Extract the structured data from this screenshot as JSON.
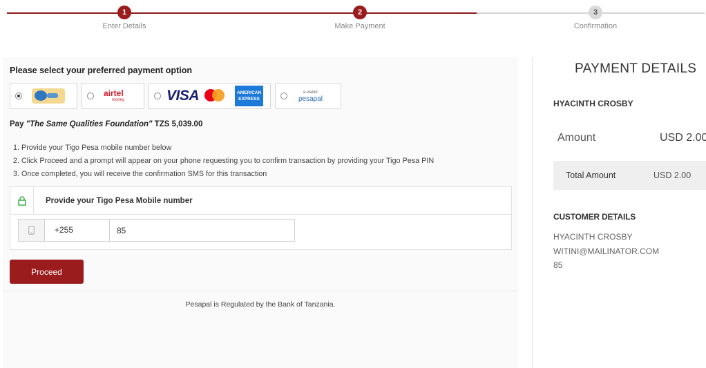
{
  "stepper": {
    "steps": [
      {
        "number": "1",
        "label": "Enter Details",
        "state": "completed"
      },
      {
        "number": "2",
        "label": "Make Payment",
        "state": "active"
      },
      {
        "number": "3",
        "label": "Confirmation",
        "state": "pending"
      }
    ],
    "accent_color": "#9b1c1c"
  },
  "payment_options": {
    "prompt": "Please select your preferred payment option",
    "options": [
      {
        "name": "tigo-pesa",
        "selected": true
      },
      {
        "name": "airtel-money",
        "selected": false,
        "logo_text": "airtel",
        "logo_subtext": "money"
      },
      {
        "name": "cards",
        "selected": false,
        "logo_text": "VISA",
        "amex_text": "AMERICAN EXPRESS"
      },
      {
        "name": "pesapal-ewallet",
        "selected": false,
        "logo_subtext": "e-wallet",
        "logo_text": "pesapal"
      }
    ]
  },
  "pay_line": {
    "prefix": "Pay ",
    "merchant": "\"The Same Qualities Foundation\"",
    "amount": " TZS 5,039.00"
  },
  "instructions": [
    "1. Provide your Tigo Pesa mobile number below",
    "2. Click Proceed and a prompt will appear on your phone requesting you to confirm transaction by providing your Tigo Pesa PIN",
    "3. Once completed, you will receive the confirmation SMS for this transaction"
  ],
  "mobile_form": {
    "title": "Provide your Tigo Pesa Mobile number",
    "country_code": "+255",
    "phone_value": "85"
  },
  "proceed_label": "Proceed",
  "footer_text": "Pesapal is Regulated by the Bank of Tanzania.",
  "payment_details": {
    "title": "PAYMENT DETAILS",
    "payer_name": "HYACINTH CROSBY",
    "amount_label": "Amount",
    "amount_value": "USD 2.00",
    "total_label": "Total Amount",
    "total_value": "USD 2.00"
  },
  "customer_details": {
    "title": "CUSTOMER DETAILS",
    "name": "HYACINTH CROSBY",
    "email": "WITINI@MAILINATOR.COM",
    "phone": "85"
  }
}
